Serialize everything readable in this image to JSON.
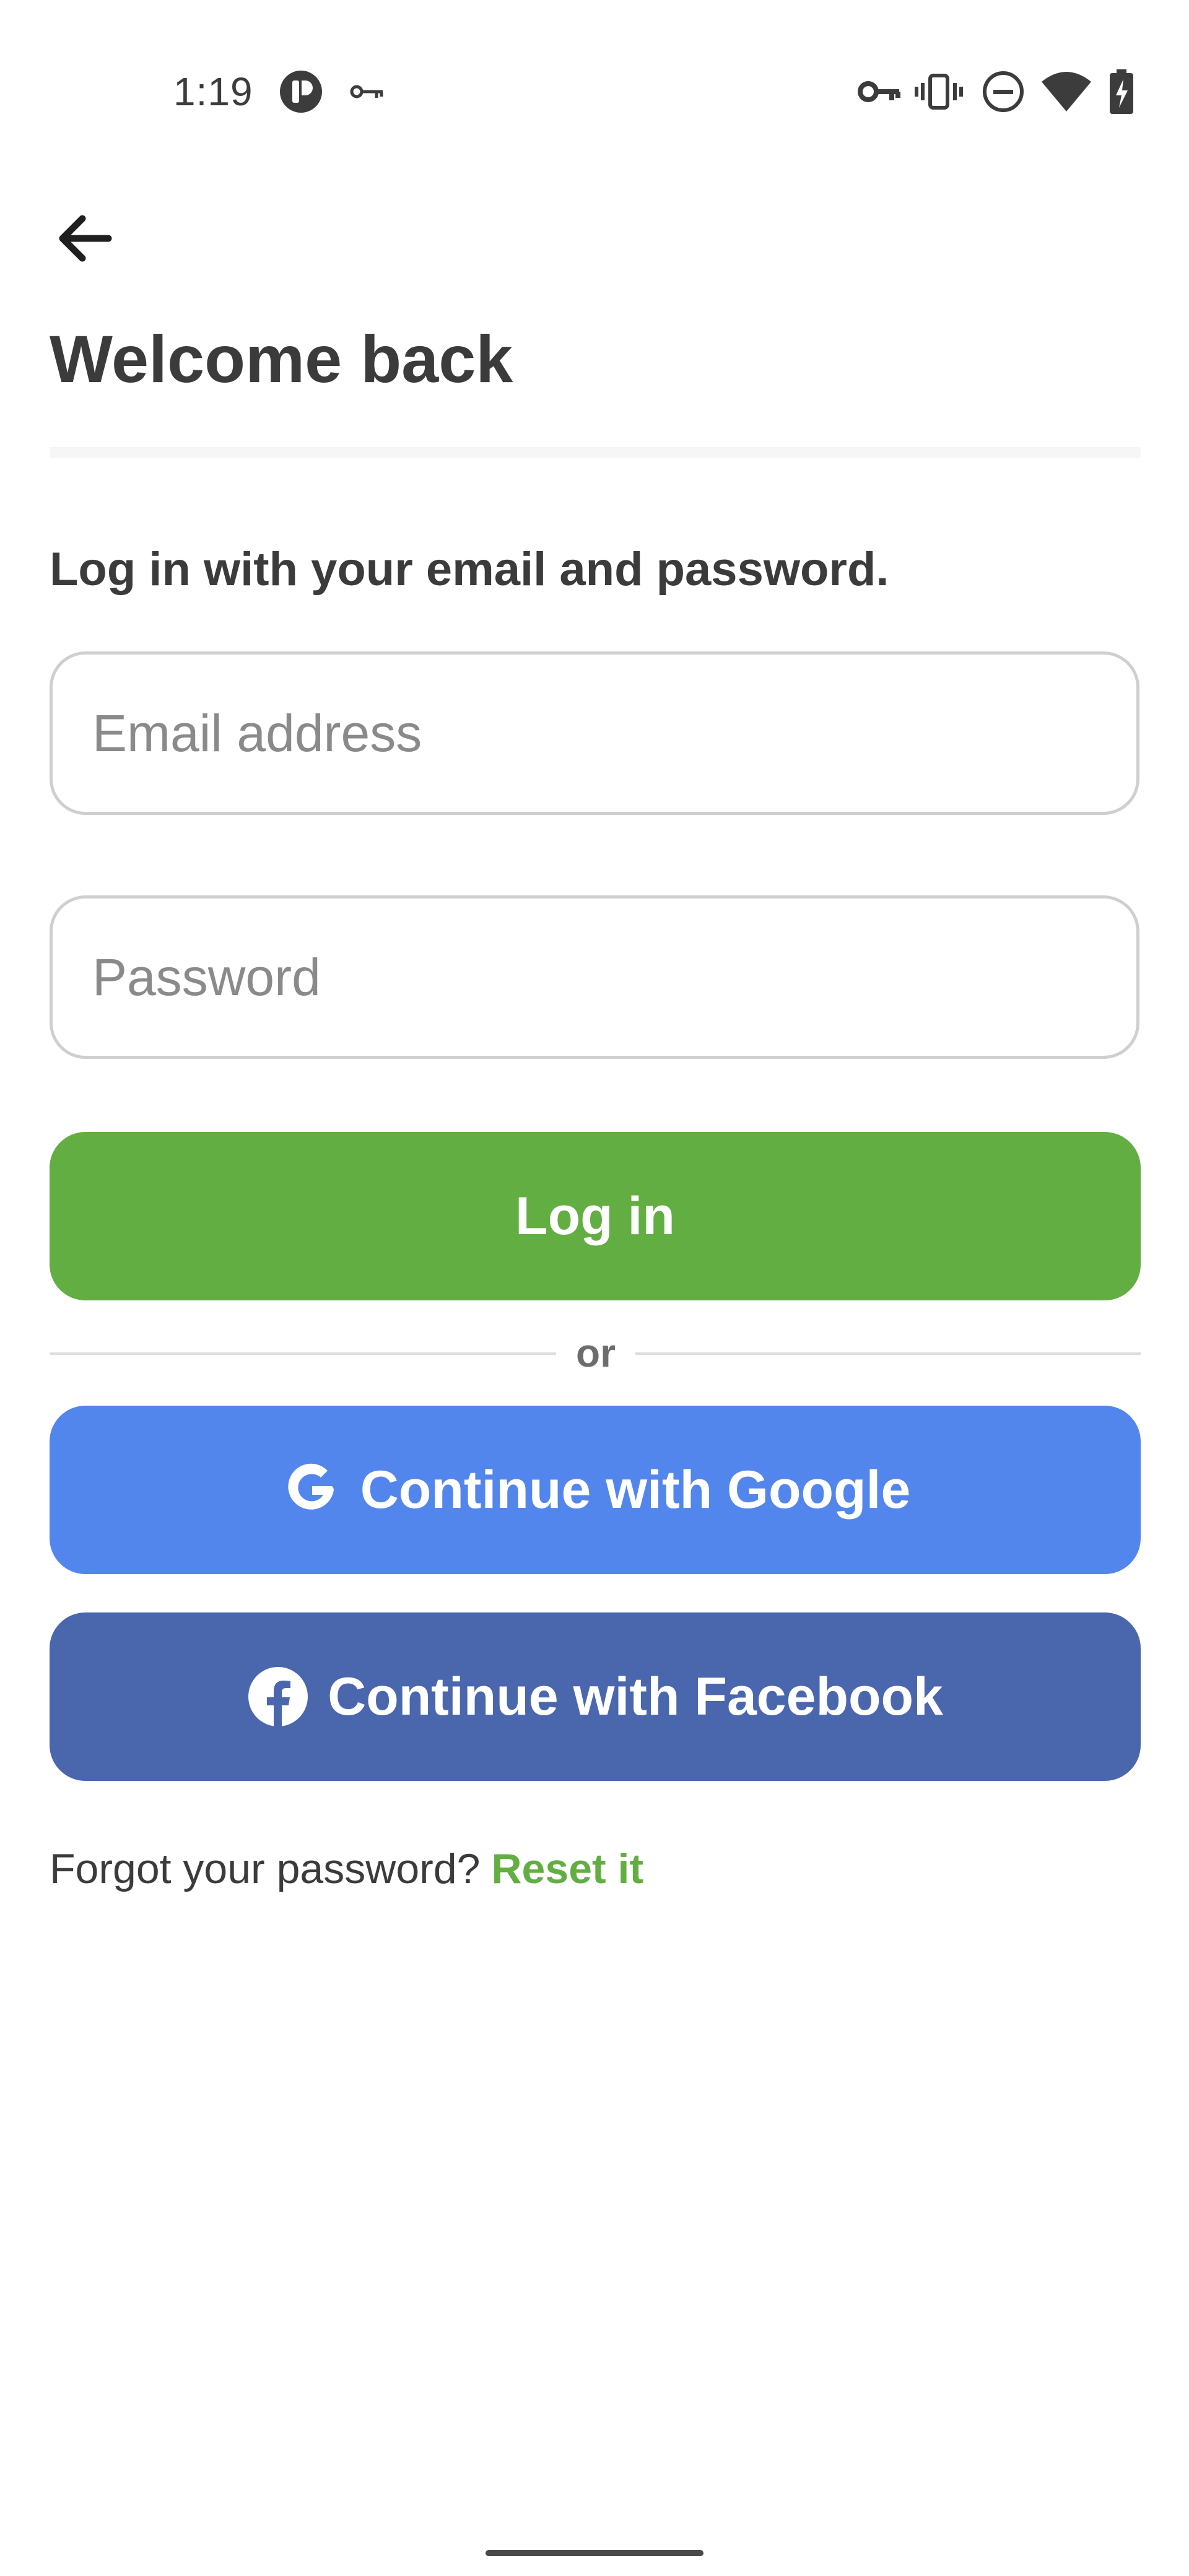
{
  "status_bar": {
    "time": "1:19",
    "left_icons": [
      "app-notification-icon",
      "vpn-key-icon"
    ],
    "right_icons": [
      "vpn-key-icon",
      "vibrate-icon",
      "do-not-disturb-icon",
      "wifi-icon",
      "battery-charging-icon"
    ]
  },
  "header": {
    "back_icon": "arrow-left-icon",
    "title": "Welcome back"
  },
  "form": {
    "instructions": "Log in with your email and password.",
    "email": {
      "value": "",
      "placeholder": "Email address"
    },
    "password": {
      "value": "",
      "placeholder": "Password"
    },
    "login_label": "Log in",
    "divider_text": "or",
    "google_label": "Continue with Google",
    "facebook_label": "Continue with Facebook"
  },
  "footer": {
    "forgot_text": "Forgot your password?",
    "reset_label": "Reset it"
  },
  "colors": {
    "accent_green": "#63ae42",
    "google_blue": "#5386ed",
    "facebook_blue": "#4a67ae"
  }
}
